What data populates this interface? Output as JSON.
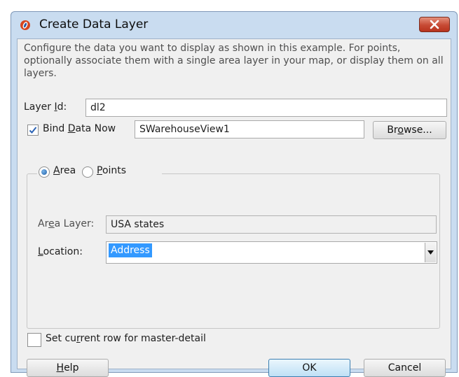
{
  "window": {
    "title": "Create Data Layer",
    "close_label": ""
  },
  "description": "Configure the data you want to display as shown in this example. For points, optionally associate them with a single area layer in your map, or display them on all layers.",
  "layer_id": {
    "label_pre": "Layer ",
    "label_mnemonic": "I",
    "label_post": "d:",
    "value": "dl2"
  },
  "bind_data": {
    "checked": true,
    "label_pre": "Bind ",
    "label_mnemonic": "D",
    "label_post": "ata Now",
    "value": "SWarehouseView1",
    "browse_pre": "Br",
    "browse_mnemonic": "o",
    "browse_post": "wse..."
  },
  "mode": {
    "area_mnemonic": "A",
    "area_rest": "rea",
    "points_mnemonic": "P",
    "points_rest": "oints",
    "selected": "area"
  },
  "area_layer": {
    "label_pre": "Ar",
    "label_mnemonic": "e",
    "label_post": "a Layer:",
    "value": "USA states"
  },
  "location": {
    "label_mnemonic": "L",
    "label_post": "ocation:",
    "value": "Address"
  },
  "master_detail": {
    "checked": false,
    "label_pre": "Set cu",
    "label_mnemonic": "r",
    "label_post": "rent row for master-detail"
  },
  "buttons": {
    "help_mnemonic": "H",
    "help_rest": "elp",
    "ok": "OK",
    "cancel": "Cancel"
  },
  "colors": {
    "frame": "#c9dcf0",
    "close": "#c74a34",
    "selection": "#3399ff"
  }
}
